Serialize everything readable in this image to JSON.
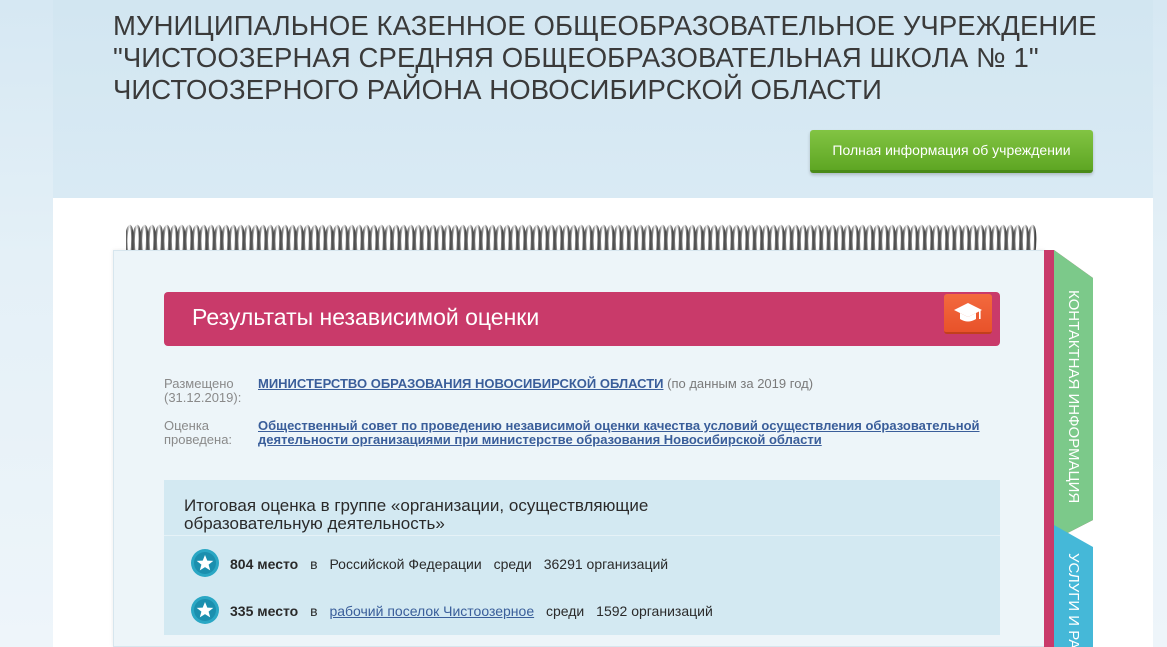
{
  "header": {
    "title_lines": [
      "МУНИЦИПАЛЬНОЕ КАЗЕННОЕ ОБЩЕОБРАЗОВАТЕЛЬНОЕ УЧРЕЖДЕНИЕ",
      "\"ЧИСТООЗЕРНАЯ СРЕДНЯЯ ОБЩЕОБРАЗОВАТЕЛЬНАЯ ШКОЛА № 1\"",
      "ЧИСТООЗЕРНОГО РАЙОНА НОВОСИБИРСКОЙ ОБЛАСТИ"
    ],
    "full_info_button": "Полная информация об учреждении"
  },
  "section": {
    "title": "Результаты независимой оценки",
    "icon": "graduation-cap-icon"
  },
  "placed": {
    "label": "Размещено (31.12.2019):",
    "link": "МИНИСТЕРСТВО ОБРАЗОВАНИЯ НОВОСИБИРСКОЙ ОБЛАСТИ",
    "note": "(по данным за 2019 год)"
  },
  "conducted": {
    "label": "Оценка проведена:",
    "link": "Общественный совет по проведению независимой оценки качества условий осуществления образовательной деятельности организациями при министерстве образования Новосибирской области"
  },
  "rating": {
    "title": "Итоговая оценка в группе «организации, осуществляющие образовательную деятельность»",
    "ranks": [
      {
        "place": "804 место",
        "in": "в",
        "region": "Российской Федерации",
        "region_is_link": false,
        "among": "среди",
        "count": "36291 организаций"
      },
      {
        "place": "335 место",
        "in": "в",
        "region": "рабочий поселок Чистоозерное",
        "region_is_link": true,
        "among": "среди",
        "count": "1592 организаций"
      }
    ]
  },
  "side_tabs": {
    "contacts": "КОНТАКТНАЯ ИНФОРМАЦИЯ",
    "services": "УСЛУГИ И РА"
  },
  "colors": {
    "banner": "#c93a6a",
    "button_green": "#6cb12f",
    "cap_orange": "#ee5e32",
    "star_teal": "#2aa7c4",
    "tab_green": "#7cc98a",
    "tab_blue": "#45b8d8",
    "link": "#3a5e9a"
  }
}
